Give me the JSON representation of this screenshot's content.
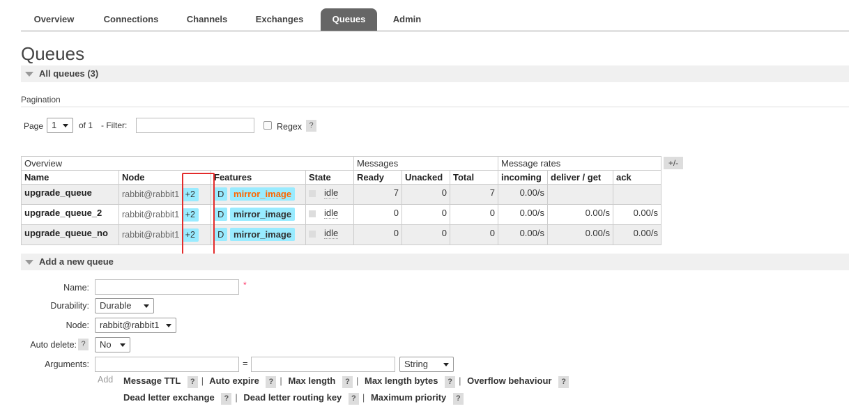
{
  "nav": {
    "tabs": [
      {
        "label": "Overview"
      },
      {
        "label": "Connections"
      },
      {
        "label": "Channels"
      },
      {
        "label": "Exchanges"
      },
      {
        "label": "Queues",
        "active": true
      },
      {
        "label": "Admin"
      }
    ]
  },
  "page_title": "Queues",
  "all_queues": {
    "header": "All queues (3)"
  },
  "pagination": {
    "label": "Pagination",
    "page_label": "Page",
    "page_value": "1",
    "of_label": "of 1",
    "filter_label": "- Filter:",
    "filter_value": "",
    "regex_label": "Regex",
    "help": "?"
  },
  "table": {
    "groups": {
      "overview": "Overview",
      "messages": "Messages",
      "rates": "Message rates"
    },
    "toggle": "+/-",
    "columns": {
      "name": "Name",
      "node": "Node",
      "features": "Features",
      "state": "State",
      "ready": "Ready",
      "unacked": "Unacked",
      "total": "Total",
      "incoming": "incoming",
      "deliver": "deliver / get",
      "ack": "ack"
    },
    "rows": [
      {
        "name": "upgrade_queue",
        "node": "rabbit@rabbit1",
        "mirrors": "+2",
        "durable": "D",
        "policy": "mirror_image",
        "state": "idle",
        "ready": "7",
        "unacked": "0",
        "total": "7",
        "incoming": "0.00/s",
        "deliver": "",
        "ack": ""
      },
      {
        "name": "upgrade_queue_2",
        "node": "rabbit@rabbit1",
        "mirrors": "+2",
        "durable": "D",
        "policy": "mirror_image",
        "state": "idle",
        "ready": "0",
        "unacked": "0",
        "total": "0",
        "incoming": "0.00/s",
        "deliver": "0.00/s",
        "ack": "0.00/s"
      },
      {
        "name": "upgrade_queue_no",
        "node": "rabbit@rabbit1",
        "mirrors": "+2",
        "durable": "D",
        "policy": "mirror_image",
        "state": "idle",
        "ready": "0",
        "unacked": "0",
        "total": "0",
        "incoming": "0.00/s",
        "deliver": "0.00/s",
        "ack": "0.00/s"
      }
    ]
  },
  "add_queue": {
    "header": "Add a new queue",
    "name_label": "Name:",
    "name_value": "",
    "required_mark": "*",
    "durability_label": "Durability:",
    "durability_value": "Durable",
    "node_label": "Node:",
    "node_value": "rabbit@rabbit1",
    "auto_delete_label": "Auto delete:",
    "auto_delete_value": "No",
    "arguments_label": "Arguments:",
    "equals": "=",
    "arg_type_value": "String",
    "add_label": "Add",
    "arg_help_row1": [
      "Message TTL",
      "Auto expire",
      "Max length",
      "Max length bytes",
      "Overflow behaviour"
    ],
    "arg_help_row2": [
      "Dead letter exchange",
      "Dead letter routing key",
      "Maximum priority"
    ]
  },
  "colors": {
    "active_tab": "#666666",
    "tag_bg": "#99ebff",
    "highlight_orange": "#ff6600",
    "annotation_red": "#e32b2b"
  }
}
